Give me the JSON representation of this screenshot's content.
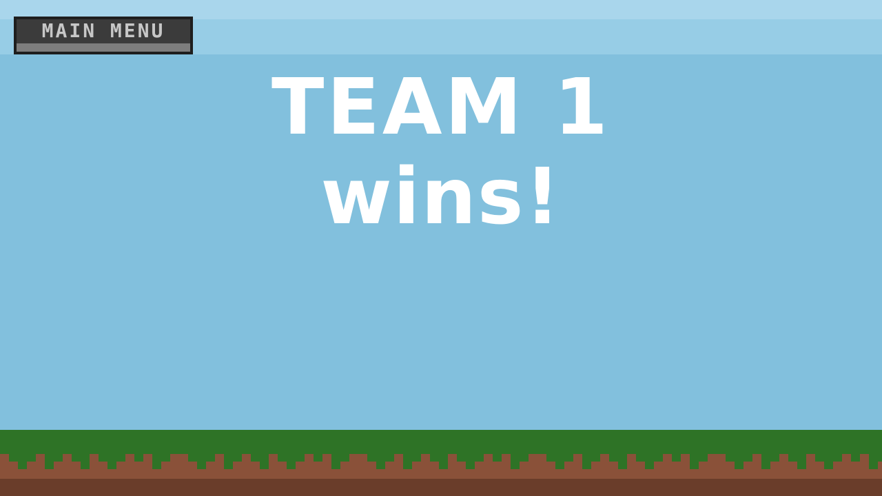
{
  "menu": {
    "label": "MAIN MENU"
  },
  "result": {
    "line1": "TEAM 1",
    "line2": "wins!"
  },
  "colors": {
    "sky_top": "#a9d6ec",
    "sky": "#82c0dd",
    "grass": "#2e7326",
    "dirt": "#8a5139",
    "dirt_dark": "#6a3d2a",
    "text": "#ffffff"
  }
}
